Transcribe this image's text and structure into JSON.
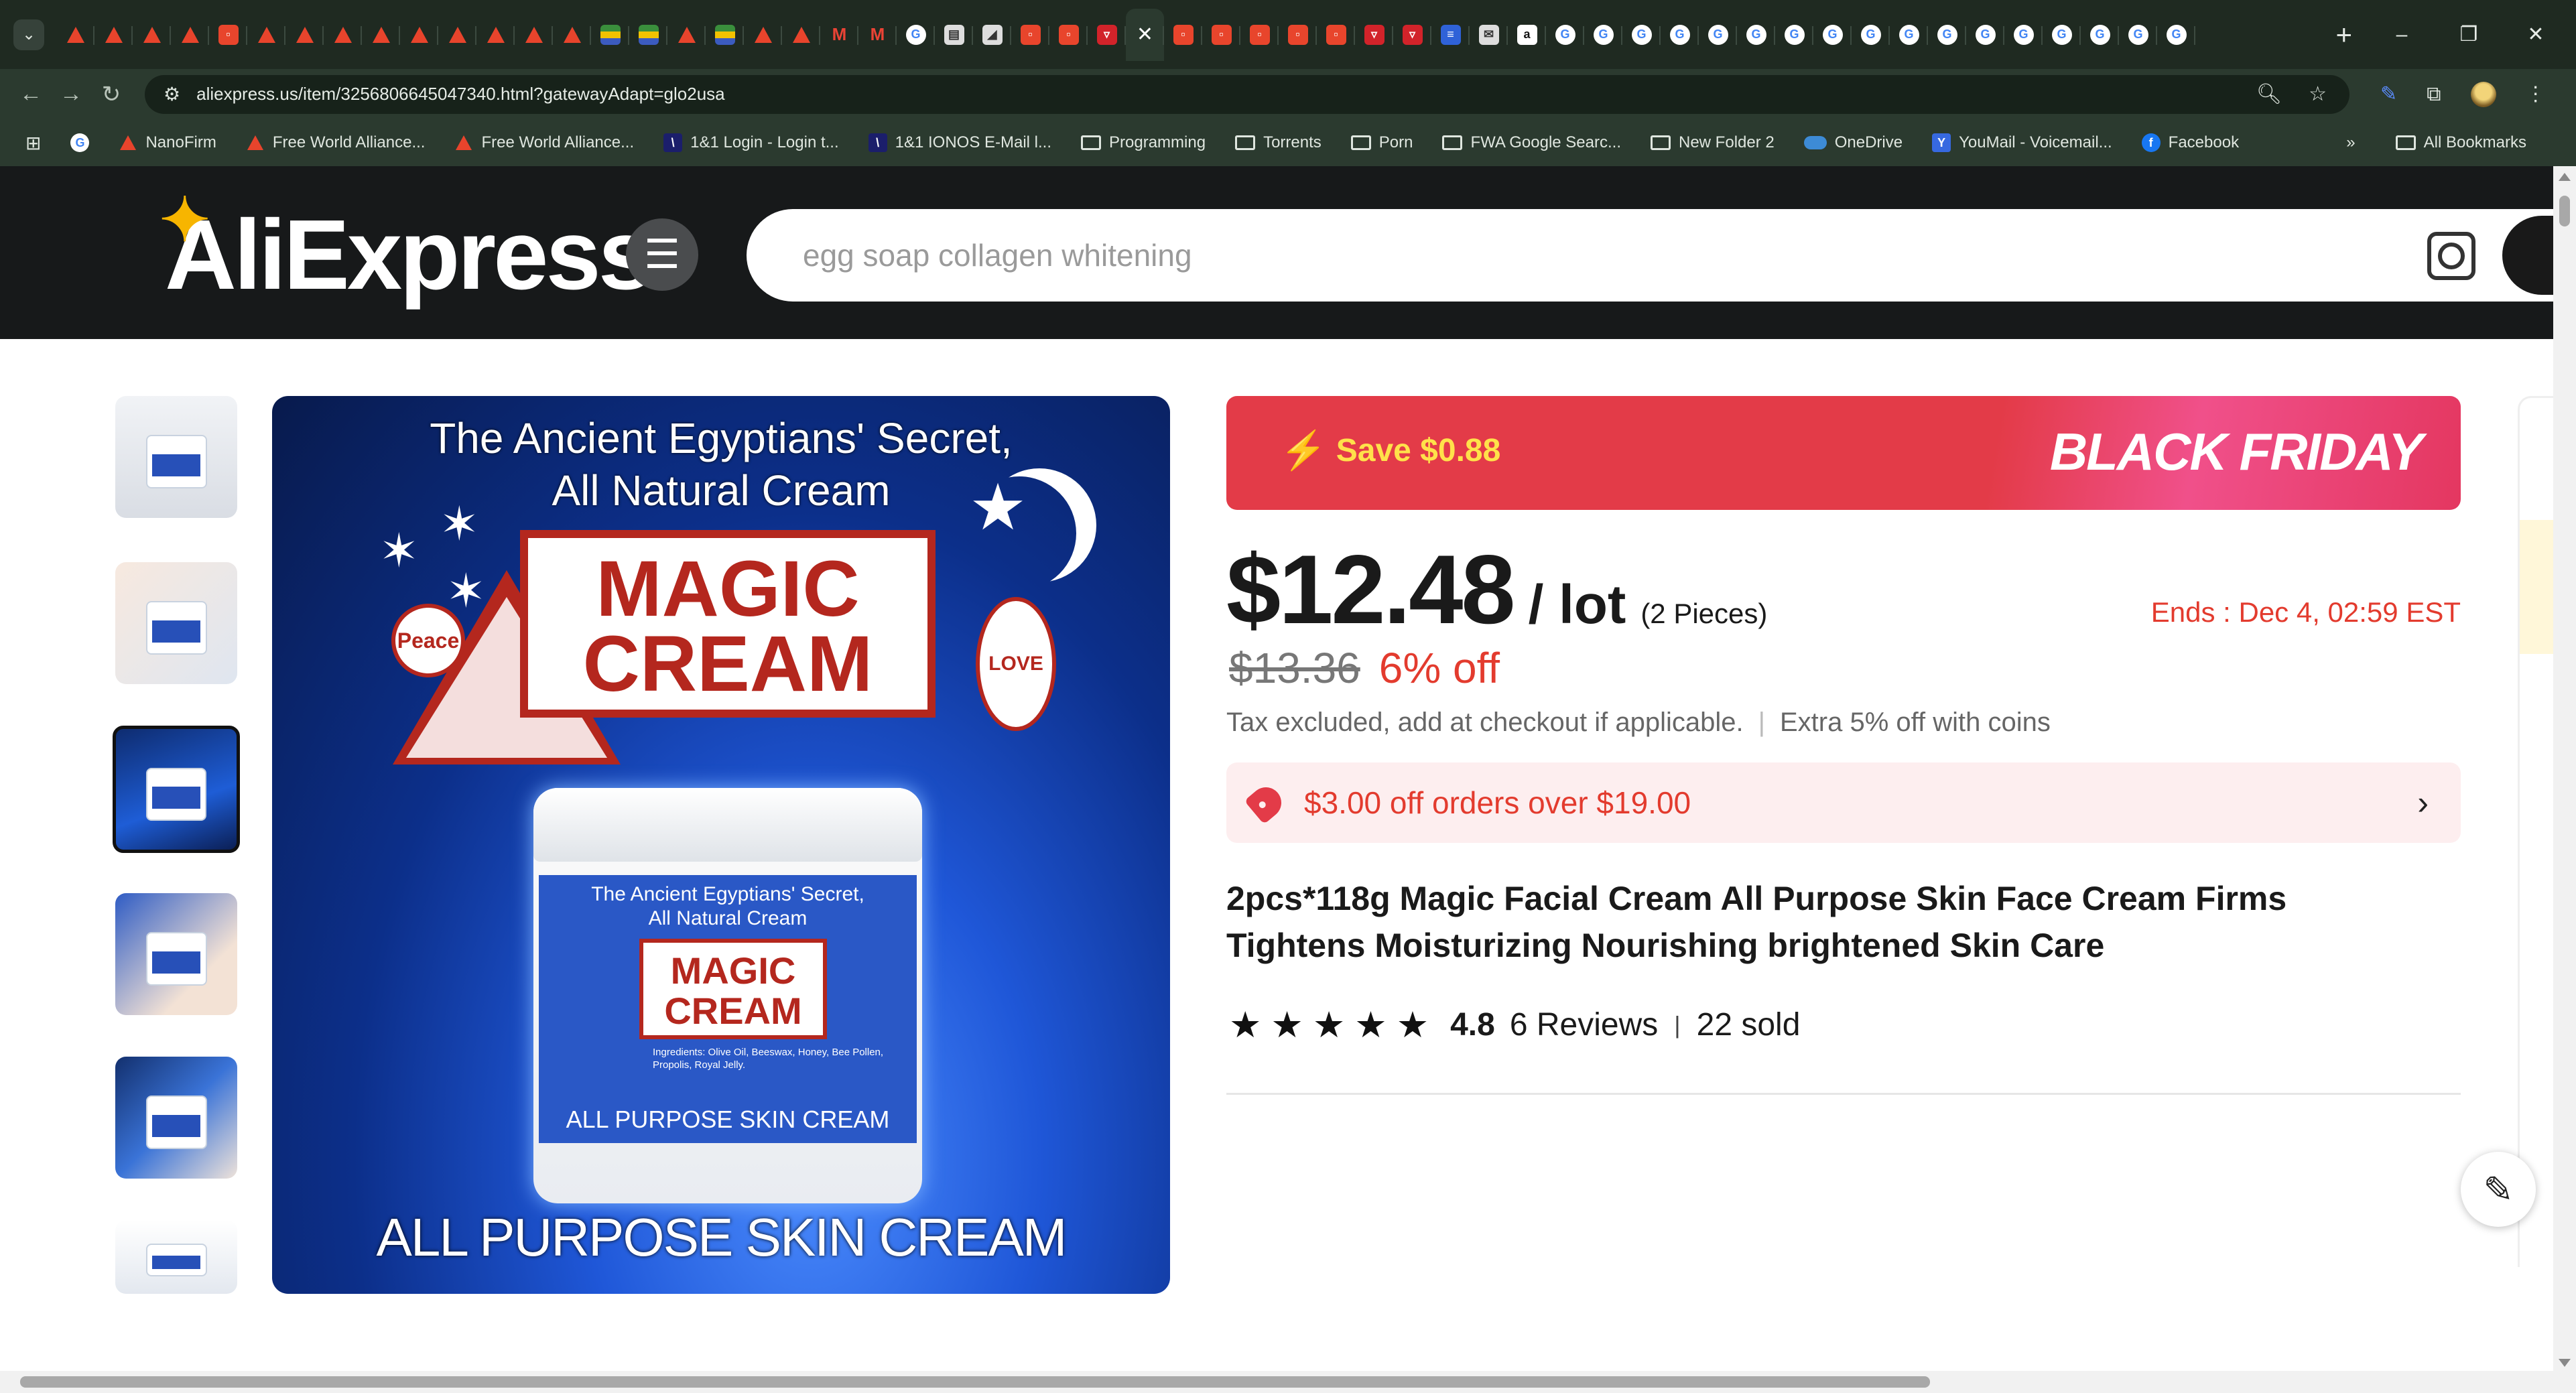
{
  "browser": {
    "tabs": [
      {
        "icon": "nanofirm-icon"
      },
      {
        "icon": "nanofirm-icon"
      },
      {
        "icon": "nanofirm-icon"
      },
      {
        "icon": "nanofirm-icon"
      },
      {
        "icon": "aliexpress-icon"
      },
      {
        "icon": "nanofirm-icon"
      },
      {
        "icon": "nanofirm-icon"
      },
      {
        "icon": "nanofirm-icon"
      },
      {
        "icon": "nanofirm-icon"
      },
      {
        "icon": "nanofirm-icon"
      },
      {
        "icon": "nanofirm-icon"
      },
      {
        "icon": "nanofirm-icon"
      },
      {
        "icon": "nanofirm-icon"
      },
      {
        "icon": "nanofirm-icon"
      },
      {
        "icon": "flag-icon"
      },
      {
        "icon": "flag-icon"
      },
      {
        "icon": "nanofirm-icon"
      },
      {
        "icon": "flag-icon"
      },
      {
        "icon": "nanofirm-icon"
      },
      {
        "icon": "nanofirm-icon"
      },
      {
        "icon": "gmail-icon"
      },
      {
        "icon": "gmail-icon"
      },
      {
        "icon": "google-icon"
      },
      {
        "icon": "page-icon"
      },
      {
        "icon": "tool-icon"
      },
      {
        "icon": "aliexpress-icon"
      },
      {
        "icon": "aliexpress-icon"
      },
      {
        "icon": "cart-icon"
      },
      {
        "icon": "close-icon",
        "active": true
      },
      {
        "icon": "aliexpress-icon"
      },
      {
        "icon": "aliexpress-icon"
      },
      {
        "icon": "aliexpress-icon"
      },
      {
        "icon": "aliexpress-icon"
      },
      {
        "icon": "aliexpress-icon"
      },
      {
        "icon": "cart-icon"
      },
      {
        "icon": "cart-icon"
      },
      {
        "icon": "blue-app-icon"
      },
      {
        "icon": "mail-icon"
      },
      {
        "icon": "amazon-icon"
      },
      {
        "icon": "google-icon"
      },
      {
        "icon": "google-icon"
      },
      {
        "icon": "google-icon"
      },
      {
        "icon": "google-icon"
      },
      {
        "icon": "google-icon"
      },
      {
        "icon": "google-icon"
      },
      {
        "icon": "google-icon"
      },
      {
        "icon": "google-icon"
      },
      {
        "icon": "google-icon"
      },
      {
        "icon": "google-icon"
      },
      {
        "icon": "google-icon"
      },
      {
        "icon": "google-icon"
      },
      {
        "icon": "google-icon"
      },
      {
        "icon": "google-icon"
      },
      {
        "icon": "google-icon"
      },
      {
        "icon": "google-icon"
      },
      {
        "icon": "google-icon"
      }
    ],
    "url": "aliexpress.us/item/3256806645047340.html?gatewayAdapt=glo2usa",
    "bookmarks": [
      {
        "icon": "google",
        "label": ""
      },
      {
        "icon": "nanofirm",
        "label": "NanoFirm"
      },
      {
        "icon": "nanofirm",
        "label": "Free World Alliance..."
      },
      {
        "icon": "nanofirm",
        "label": "Free World Alliance..."
      },
      {
        "icon": "ionos",
        "label": "1&1 Login - Login t..."
      },
      {
        "icon": "ionos",
        "label": "1&1 IONOS E-Mail l..."
      },
      {
        "icon": "folder",
        "label": "Programming"
      },
      {
        "icon": "folder",
        "label": "Torrents"
      },
      {
        "icon": "folder",
        "label": "Porn"
      },
      {
        "icon": "folder",
        "label": "FWA Google Searc..."
      },
      {
        "icon": "folder",
        "label": "New Folder 2"
      },
      {
        "icon": "onedrive",
        "label": "OneDrive"
      },
      {
        "icon": "youmail",
        "label": "YouMail - Voicemail..."
      },
      {
        "icon": "facebook",
        "label": "Facebook"
      }
    ],
    "all_bookmarks_label": "All Bookmarks",
    "overflow_label": "»"
  },
  "site": {
    "logo_text": "AliExpress",
    "search_placeholder": "egg soap collagen whitening"
  },
  "main_image": {
    "title_line1": "The Ancient Egyptians' Secret,",
    "title_line2": "All Natural Cream",
    "banner_line1": "MAGIC",
    "banner_line2": "CREAM",
    "peace_label": "Peace",
    "love_label": "LOVE",
    "jar_line1": "The Ancient Egyptians' Secret,",
    "jar_line2": "All Natural Cream",
    "jar_banner": "MAGIC CREAM",
    "jar_ingredients": "Ingredients: Olive Oil, Beeswax, Honey, Bee Pollen, Propolis, Royal Jelly.",
    "jar_bottom": "ALL PURPOSE SKIN CREAM",
    "bottom_caption": "ALL PURPOSE SKIN CREAM"
  },
  "promo": {
    "save_label": "Save $0.88",
    "banner_title": "BLACK FRIDAY"
  },
  "price": {
    "current": "$12.48",
    "unit": "/ lot",
    "pieces": "(2 Pieces)",
    "ends": "Ends :  Dec 4, 02:59 EST",
    "original": "$13.36",
    "discount": "6% off",
    "tax_note": "Tax excluded, add at checkout if applicable.",
    "coins_note": "Extra 5% off with coins"
  },
  "coupon": {
    "text": "$3.00 off orders over $19.00"
  },
  "product": {
    "title": "2pcs*118g Magic Facial Cream All Purpose Skin Face Cream Firms Tightens Moisturizing Nourishing brightened Skin Care",
    "rating": "4.8",
    "stars": 5,
    "reviews": "6 Reviews",
    "sold": "22 sold"
  },
  "thumbnails": [
    {
      "name": "thumb-jars"
    },
    {
      "name": "thumb-face"
    },
    {
      "name": "thumb-magic-cream",
      "selected": true
    },
    {
      "name": "thumb-collage"
    },
    {
      "name": "thumb-model"
    },
    {
      "name": "thumb-jars-2"
    }
  ]
}
